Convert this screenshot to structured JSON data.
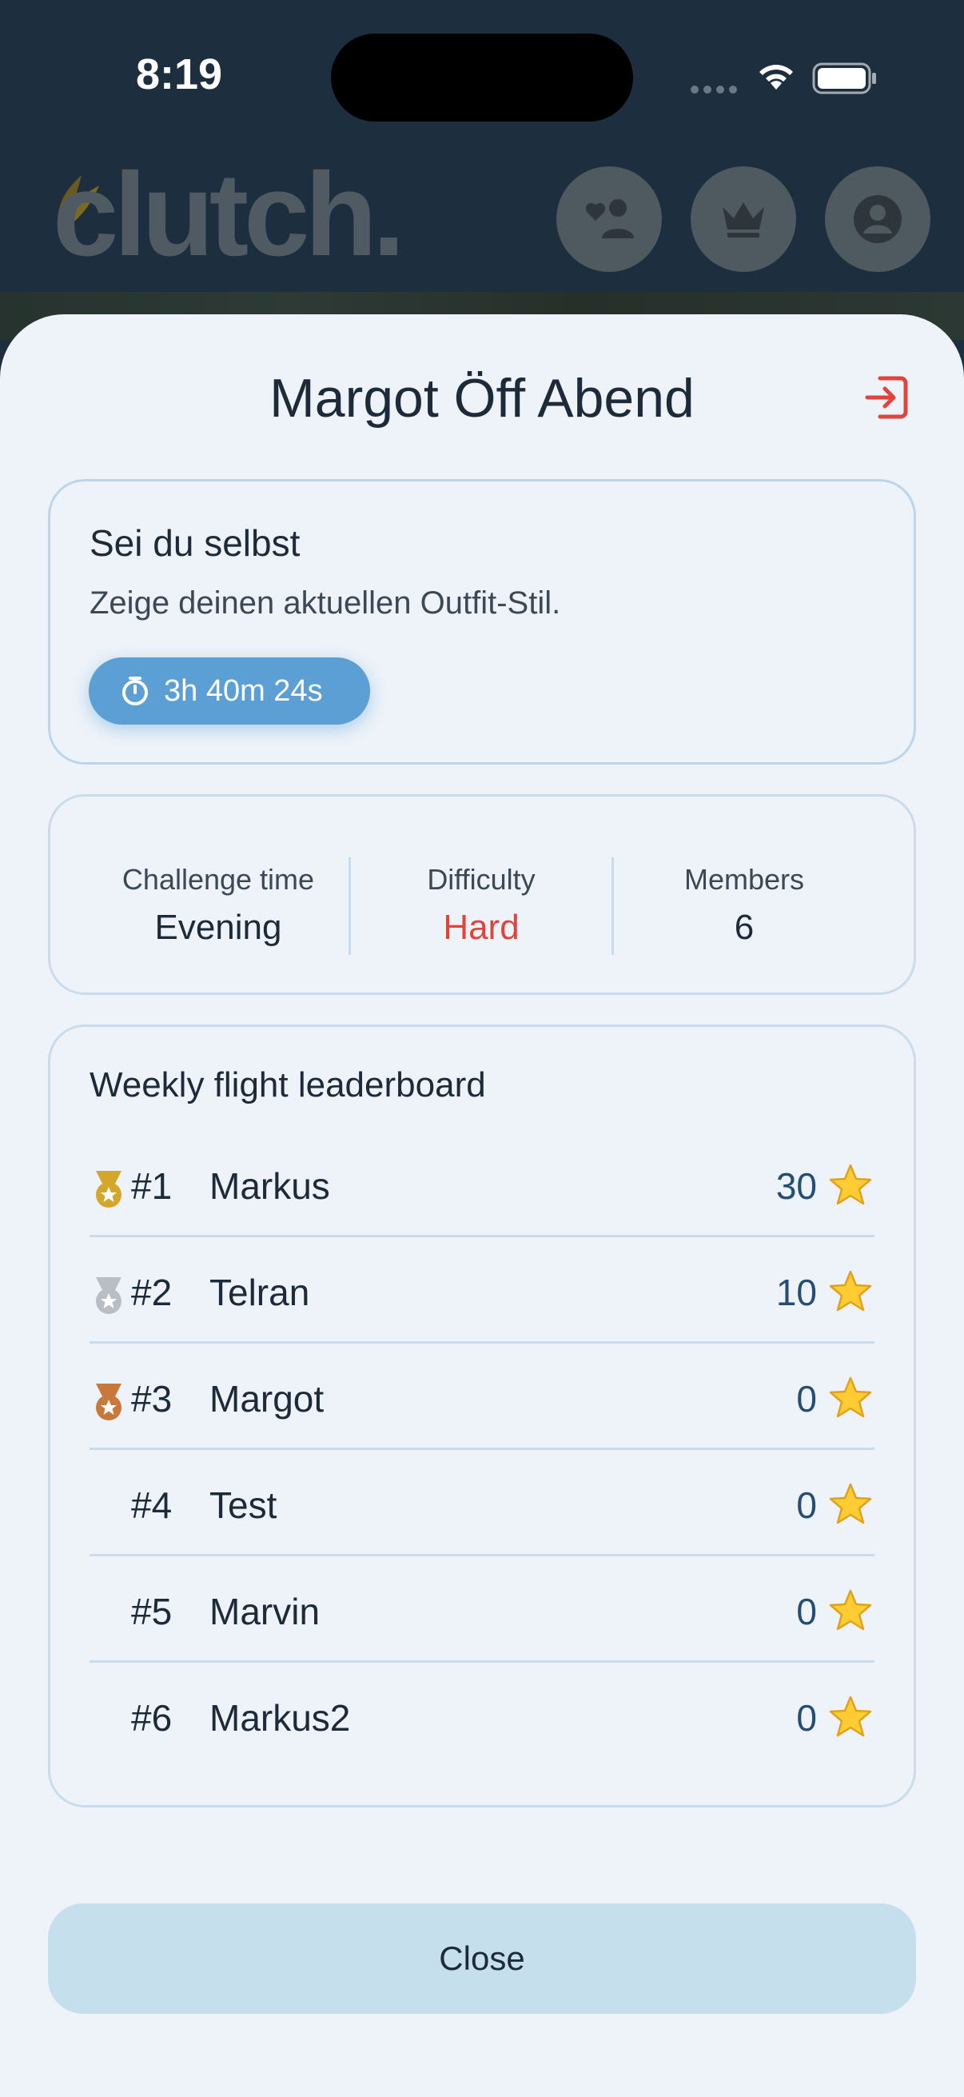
{
  "status_bar": {
    "time": "8:19"
  },
  "app": {
    "logo_text": "clutch.",
    "header_icons": [
      "friends-icon",
      "crown-icon",
      "profile-icon"
    ]
  },
  "sheet": {
    "title": "Margot Öff Abend",
    "exit_icon": "exit-icon",
    "challenge": {
      "title": "Sei du selbst",
      "description": "Zeige deinen aktuellen Outfit-Stil.",
      "timer": "3h 40m 24s"
    },
    "stats": [
      {
        "label": "Challenge time",
        "value": "Evening"
      },
      {
        "label": "Difficulty",
        "value": "Hard"
      },
      {
        "label": "Members",
        "value": "6"
      }
    ],
    "leaderboard": {
      "title": "Weekly flight leaderboard",
      "rows": [
        {
          "rank": "#1",
          "name": "Markus",
          "score": "30",
          "medal": "gold"
        },
        {
          "rank": "#2",
          "name": "Telran",
          "score": "10",
          "medal": "silver"
        },
        {
          "rank": "#3",
          "name": "Margot",
          "score": "0",
          "medal": "bronze"
        },
        {
          "rank": "#4",
          "name": "Test",
          "score": "0",
          "medal": ""
        },
        {
          "rank": "#5",
          "name": "Marvin",
          "score": "0",
          "medal": ""
        },
        {
          "rank": "#6",
          "name": "Markus2",
          "score": "0",
          "medal": ""
        }
      ]
    },
    "close_label": "Close"
  },
  "colors": {
    "accent": "#5b9fd4",
    "difficulty": "#e0443a",
    "exit": "#e0443a",
    "gold": "#d4a72c",
    "silver": "#b9bec4",
    "bronze": "#c8783a"
  }
}
